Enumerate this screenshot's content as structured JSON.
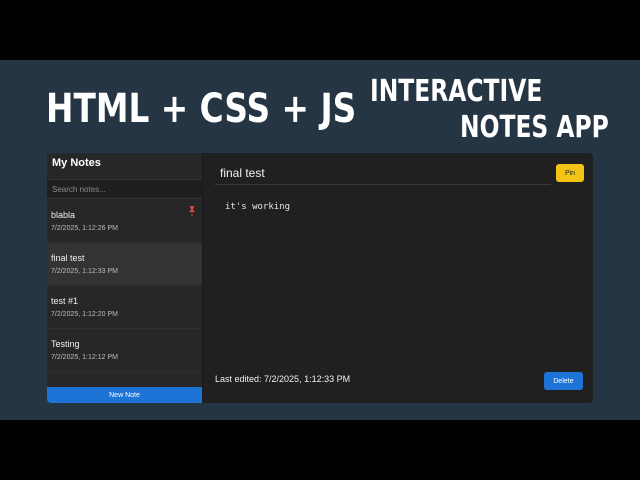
{
  "headline": {
    "left": "HTML + CSS + JS",
    "right_line1": "INTERACTIVE",
    "right_line2": "NOTES APP"
  },
  "sidebar": {
    "title": "My Notes",
    "search_placeholder": "Search notes...",
    "new_note_label": "New Note",
    "notes": [
      {
        "title": "blabla",
        "date": "7/2/2025, 1:12:26 PM",
        "pinned": true
      },
      {
        "title": "final test",
        "date": "7/2/2025, 1:12:33 PM",
        "active": true
      },
      {
        "title": "test #1",
        "date": "7/2/2025, 1:12:20 PM"
      },
      {
        "title": "Testing",
        "date": "7/2/2025, 1:12:12 PM"
      }
    ]
  },
  "editor": {
    "title_value": "final test",
    "pin_label": "Pin",
    "body": "it's working",
    "last_edited": "Last edited: 7/2/2025, 1:12:33 PM",
    "delete_label": "Delete"
  },
  "colors": {
    "background": "#253544",
    "accent_blue": "#1e74d6",
    "pin_yellow": "#f3c316",
    "pin_icon_red": "#e0463c"
  },
  "icons": {
    "pinned_note": "pushpin-icon"
  }
}
